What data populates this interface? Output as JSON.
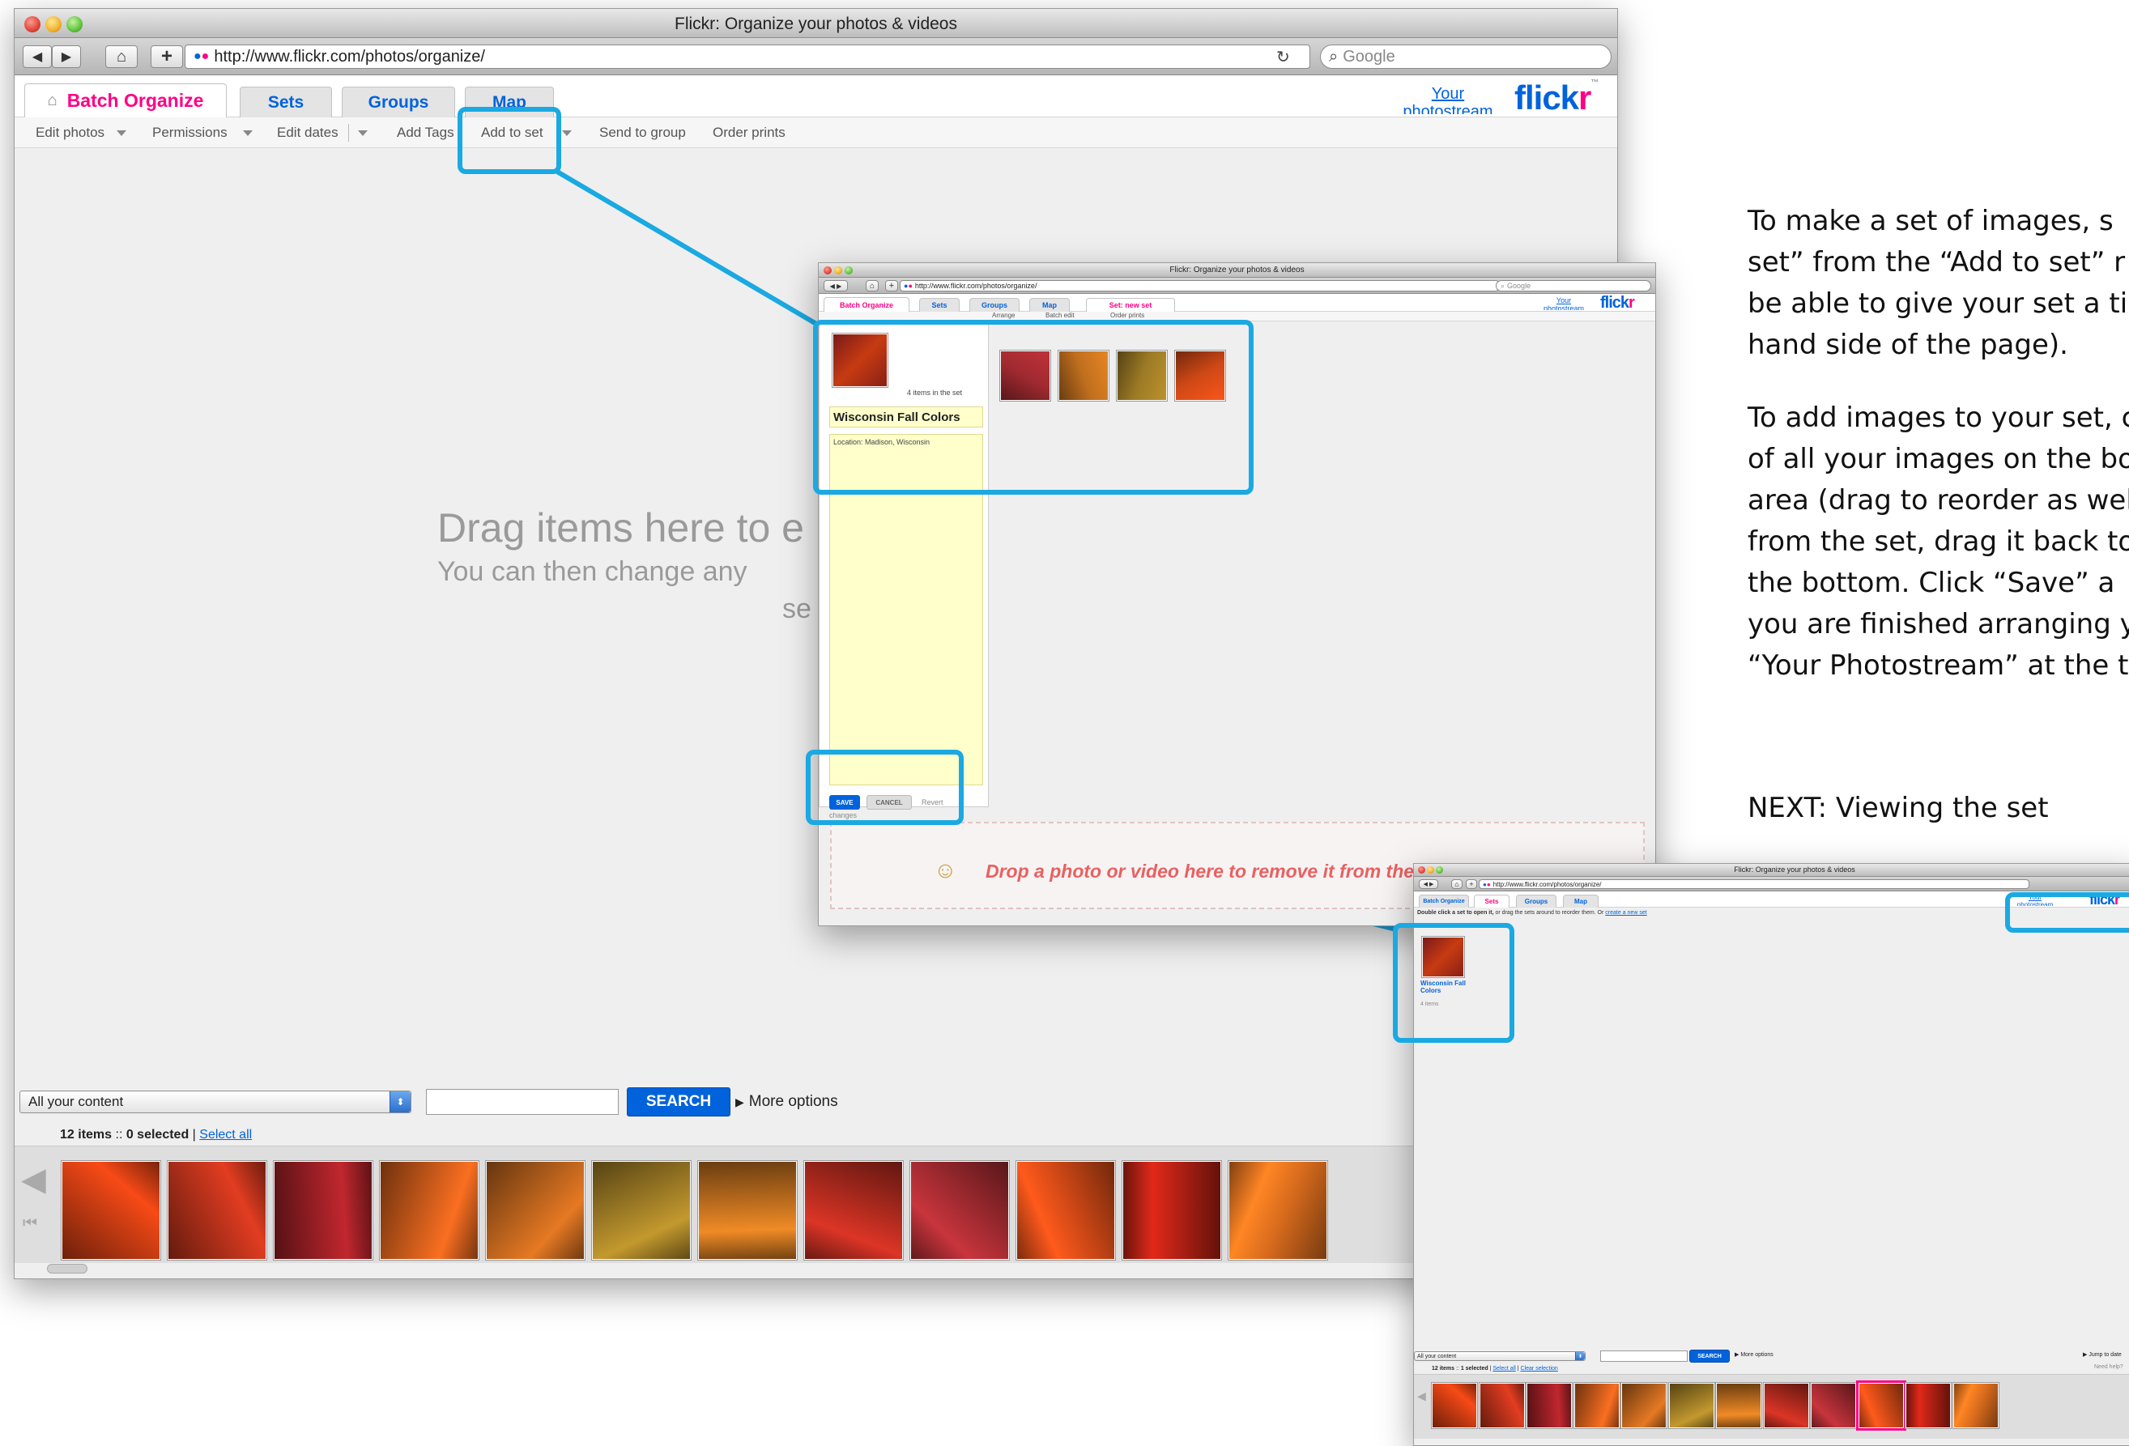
{
  "browser": {
    "title": "Flickr: Organize your photos & videos",
    "url": "http://www.flickr.com/photos/organize/",
    "search_placeholder": "Google"
  },
  "flickr": {
    "logo": "flickr",
    "your_photostream": "Your photostream",
    "tabs": [
      "Batch Organize",
      "Sets",
      "Groups",
      "Map"
    ],
    "menu": [
      "Edit photos",
      "Permissions",
      "Edit dates",
      "Add Tags",
      "Add to set",
      "Send to group",
      "Order prints"
    ],
    "drag_headline": "Drag items here to e",
    "drag_sub": "You can then change any",
    "drag_sub2": "se",
    "content_filter": "All your content",
    "search_button": "SEARCH",
    "more_options": "More options",
    "items_count": "12 items",
    "selected_count": "0 selected",
    "select_all": "Select all"
  },
  "set_window": {
    "tabs": [
      "Batch Organize",
      "Sets",
      "Groups",
      "Map",
      "Set: new set"
    ],
    "subtoolbar": [
      "Arrange",
      "Batch edit",
      "Order prints"
    ],
    "items_in_set": "4 items in the set",
    "set_title": "Wisconsin Fall Colors",
    "set_description": "Location: Madison, Wisconsin",
    "save": "SAVE",
    "cancel": "CANCEL",
    "revert": "Revert",
    "revert2": "changes",
    "drop_text": "Drop a photo or video here to remove it from the set"
  },
  "sets_window": {
    "instruction_bold": "Double click a set to open it,",
    "instruction_rest": "or drag the sets around to reorder them. Or",
    "create_link": "create a new set",
    "set_name": "Wisconsin Fall Colors",
    "set_count": "4 items",
    "bottom_items": "12 items",
    "bottom_selected": "1 selected",
    "bottom_select_all": "Select all",
    "bottom_clear": "Clear selection",
    "jump": "Jump to date",
    "need_help": "Need help?"
  },
  "instructions": {
    "p1": [
      "To make a set of images, s",
      "set” from the “Add to set” r",
      "be able to give your set a ti",
      "hand side of the page)."
    ],
    "p2": [
      "To add images to your set, c",
      "of all your images on the bo",
      "area (drag to reorder as wel",
      "from the set, drag it back to t",
      "the bottom.  Click “Save” a",
      "you are finished arranging y",
      "“Your Photostream” at the t"
    ],
    "next": "NEXT:  Viewing the set"
  },
  "colors": {
    "flickr_blue": "#0063dc",
    "flickr_pink": "#ff0084",
    "callout": "#1aa9e2",
    "thumbs": [
      "#c63b12",
      "#b5311a",
      "#9a1f25",
      "#c8591a",
      "#b8611c",
      "#9c7a25",
      "#c06f1e",
      "#b02a1e",
      "#a02a30",
      "#cf4816",
      "#b42114",
      "#d86b1d"
    ]
  }
}
